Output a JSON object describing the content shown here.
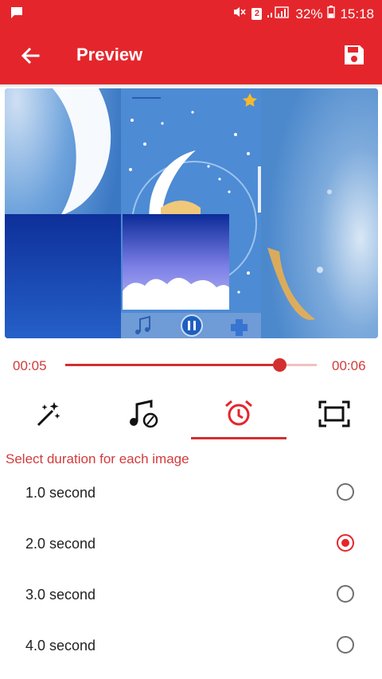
{
  "status_bar": {
    "sim_slot": "2",
    "battery": "32%",
    "time": "15:18"
  },
  "toolbar": {
    "title": "Preview",
    "back_icon": "arrow-left-icon",
    "save_icon": "save-icon"
  },
  "player": {
    "current_time": "00:05",
    "total_time": "00:06",
    "progress": 0.85
  },
  "tabs": [
    {
      "icon": "magic-wand-icon",
      "active": false
    },
    {
      "icon": "music-note-icon",
      "active": false
    },
    {
      "icon": "alarm-clock-icon",
      "active": true
    },
    {
      "icon": "fullscreen-icon",
      "active": false
    }
  ],
  "duration": {
    "label": "Select duration for each image",
    "options": [
      {
        "label": "1.0 second",
        "selected": false
      },
      {
        "label": "2.0 second",
        "selected": true
      },
      {
        "label": "3.0 second",
        "selected": false
      },
      {
        "label": "4.0 second",
        "selected": false
      }
    ]
  },
  "colors": {
    "accent": "#e4262c",
    "accent_text": "#d23b3b"
  }
}
